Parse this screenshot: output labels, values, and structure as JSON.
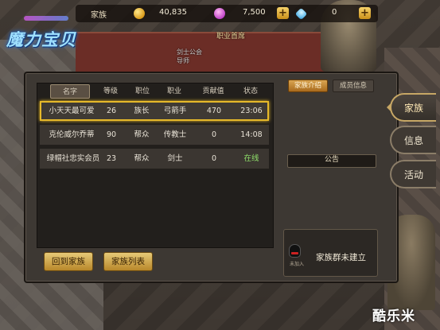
{
  "game": {
    "logo_text": "魔力宝贝"
  },
  "topbar": {
    "title": "家族",
    "gold": "40,835",
    "crystal": "7,500",
    "diamond": "0",
    "gold_icon": "gold-coin-icon",
    "crystal_icon": "purple-gem-icon",
    "diamond_icon": "blue-diamond-icon"
  },
  "world": {
    "npc_title": "职业首席",
    "npc_name": "剑士公会\n导师"
  },
  "panel": {
    "columns": [
      "名字",
      "等级",
      "职位",
      "职业",
      "贡献值",
      "状态"
    ],
    "members": [
      {
        "name": "小天天最可爱",
        "level": "26",
        "position": "族长",
        "job": "弓箭手",
        "contribution": "470",
        "status": "23:06"
      },
      {
        "name": "克伦威尔乔蒂",
        "level": "90",
        "position": "帮众",
        "job": "传教士",
        "contribution": "0",
        "status": "14:08"
      },
      {
        "name": "绿帽社忠实会员",
        "level": "23",
        "position": "帮众",
        "job": "剑士",
        "contribution": "0",
        "status": "在线"
      }
    ],
    "back_button": "回到家族",
    "list_button": "家族列表",
    "tab_intro": "家族介绍",
    "tab_members": "成员信息",
    "notice_label": "公告",
    "qq_label": "家族群未建立",
    "qq_sub": "未加入"
  },
  "side_tabs": {
    "family": "家族",
    "info": "信息",
    "activity": "活动"
  },
  "watermark": "酷乐米"
}
